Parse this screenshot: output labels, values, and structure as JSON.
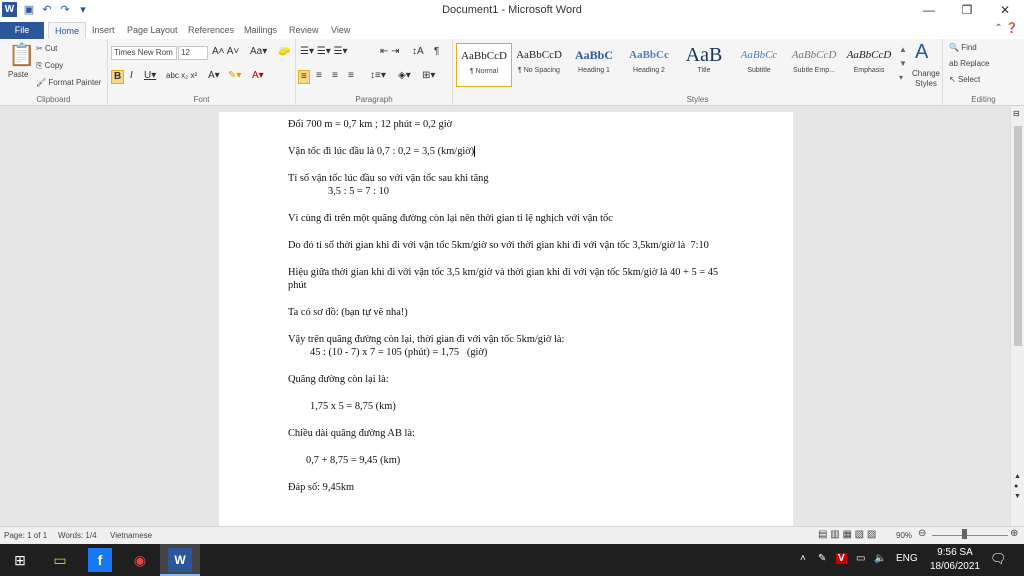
{
  "window": {
    "title": "Document1 - Microsoft Word",
    "controls": [
      "—",
      "❐",
      "✕"
    ]
  },
  "tabs": [
    "File",
    "Home",
    "Insert",
    "Page Layout",
    "References",
    "Mailings",
    "Review",
    "View"
  ],
  "ribbon": {
    "clipboard": {
      "paste": "Paste",
      "cut": "Cut",
      "copy": "Copy",
      "format_painter": "Format Painter",
      "label": "Clipboard"
    },
    "font": {
      "name": "Times New Rom",
      "size": "12",
      "label": "Font"
    },
    "paragraph": {
      "label": "Paragraph"
    },
    "styles": {
      "label": "Styles",
      "items": [
        {
          "preview": "AaBbCcD",
          "name": "¶ Normal"
        },
        {
          "preview": "AaBbCcD",
          "name": "¶ No Spacing"
        },
        {
          "preview": "AaBbC",
          "name": "Heading 1"
        },
        {
          "preview": "AaBbCc",
          "name": "Heading 2"
        },
        {
          "preview": "AaB",
          "name": "Title"
        },
        {
          "preview": "AaBbCc",
          "name": "Subtitle"
        },
        {
          "preview": "AaBbCcD",
          "name": "Subtle Emp..."
        },
        {
          "preview": "AaBbCcD",
          "name": "Emphasis"
        }
      ],
      "change_styles": "Change Styles"
    },
    "editing": {
      "find": "Find",
      "replace": "Replace",
      "select": "Select",
      "label": "Editing"
    }
  },
  "document": {
    "lines": [
      "Đổi 700 m = 0,7 km ; 12 phút = 0,2 giờ",
      "Vận tốc đi lúc đầu là 0,7 : 0,2 = 3,5 (km/giờ)",
      "Tỉ số vận tốc lúc đầu so với vận tốc sau khi tăng",
      "3,5 : 5 = 7 : 10",
      "Vì cùng đi trên một quãng đường còn lại nên thời gian tỉ lệ nghịch với vận tốc",
      "Do đó tỉ số thời gian khi đi với vận tốc 5km/giờ so với thời gian khi đi với vận tốc 3,5km/giờ là  7:10",
      "Hiệu giữa thời gian khi đi với vận tốc 3,5 km/giờ và thời gian khi đi với vận tốc 5km/giờ là 40 + 5 = 45 phút",
      "Ta có sơ đồ: (bạn tự vẽ nha!)",
      "Vậy trên quãng đường còn lại, thời gian đi với vận tốc 5km/giờ là:",
      "45 : (10 - 7) x 7 = 105 (phút) = 1,75   (giờ)",
      "Quãng đường còn lại là:",
      "1,75 x 5 = 8,75 (km)",
      "Chiều dài quãng đường AB là:",
      "0,7 + 8,75 = 9,45 (km)",
      "Đáp số: 9,45km"
    ]
  },
  "status": {
    "page": "Page: 1 of 1",
    "words": "Words: 1/4",
    "language": "Vietnamese",
    "zoom": "90%"
  },
  "taskbar": {
    "lang": "ENG",
    "time": "9:56 SA",
    "date": "18/06/2021"
  }
}
